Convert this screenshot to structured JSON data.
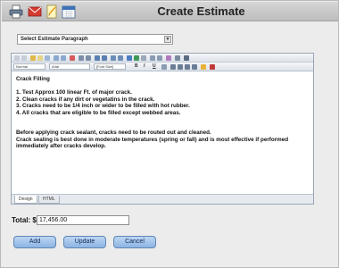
{
  "header": {
    "title": "Create Estimate",
    "icons": [
      "printer-icon",
      "email-icon",
      "notepad-icon",
      "calendar-icon"
    ]
  },
  "paragraph_select": {
    "value": "Select Estimate Paragraph"
  },
  "editor": {
    "toolbar": {
      "format_value": "Normal",
      "font_value": "Arial",
      "size_value": "[Font Size]",
      "bold": "B",
      "italic": "I",
      "underline": "U"
    },
    "content": {
      "heading": "Crack Filling",
      "items": [
        "1. Test Approx 100 linear Ft. of major crack.",
        "2. Clean cracks if any dirt or vegetatins in the crack.",
        "3. Cracks need to be 1/4 inch or wider to be filled with hot rubber.",
        "4. All cracks that are eligible to be filled except webbed areas."
      ],
      "note_line1": "Before applying crack sealant, cracks need to be routed out and cleaned.",
      "note_line2": "Crack sealing is best done in moderate temperatures (spring or fall) and is most effective if performed",
      "note_line3": "immediately after cracks develop."
    },
    "tabs": [
      "Design",
      "HTML"
    ],
    "active_tab": "Design"
  },
  "total": {
    "label": "Total: $",
    "value": "17,456.00"
  },
  "buttons": {
    "add": "Add",
    "update": "Update",
    "cancel": "Cancel"
  },
  "colors": {
    "button_fill": "#9fc1ea",
    "header_bg": "#c9c9c9"
  }
}
